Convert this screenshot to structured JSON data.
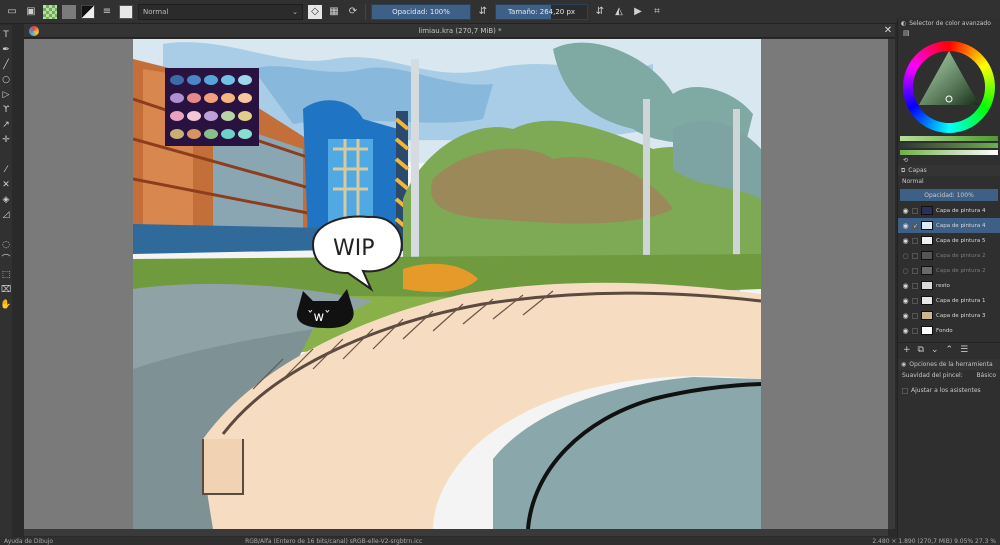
{
  "toolbar": {
    "blend_mode": "Normal",
    "opacity_label": "Opacidad: 100%",
    "opacity_value": 1.0,
    "size_label": "Tamaño: 264,20 px",
    "size_fill": 0.6,
    "icons": [
      "folder-icon",
      "save-icon",
      "gradient-pattern-icon",
      "fill-pattern-icon",
      "swap-colors-icon",
      "brush-settings-icon",
      "brush-preset-icon",
      "eraser-icon",
      "alpha-lock-icon",
      "reload-icon",
      "mirror-horizontal-icon",
      "mirror-vertical-icon",
      "crop-icon"
    ]
  },
  "tabs": {
    "active_title": "limiau.kra (270,7 MiB) *"
  },
  "canvas": {
    "bubble_text": "WIP",
    "cat_text": "ˇwˇ",
    "palette_colors": [
      "#3c6aa8",
      "#4a86c5",
      "#56a5d8",
      "#6fc2e6",
      "#9fd6ea",
      "#b08fd2",
      "#e58a8a",
      "#f0a07a",
      "#f3b680",
      "#f7c7a0",
      "#e9a3c1",
      "#f4c7d6",
      "#c0a0d8",
      "#b9d3a8",
      "#e0d08a",
      "#c8b072",
      "#d49565",
      "#89c08a",
      "#6fd1c9",
      "#86e0d0"
    ]
  },
  "dock": {
    "color_title": "Selector de color avanzado",
    "layers_title": "Capas",
    "layers_blend": "Normal",
    "layers_opacity": "Opacidad:  100%",
    "layers": [
      {
        "name": "Capa de pintura 4",
        "visible": true,
        "selected": false,
        "dim": false,
        "thumb": "#2b2f5a",
        "check": ""
      },
      {
        "name": "Capa de pintura 4",
        "visible": true,
        "selected": true,
        "dim": false,
        "thumb": "#dfeaf3",
        "check": "✓"
      },
      {
        "name": "Capa de pintura 5",
        "visible": true,
        "selected": false,
        "dim": false,
        "thumb": "#f0f0f0",
        "check": ""
      },
      {
        "name": "Capa de pintura 2",
        "visible": false,
        "selected": false,
        "dim": true,
        "thumb": "#555",
        "check": ""
      },
      {
        "name": "Capa de pintura 2",
        "visible": false,
        "selected": false,
        "dim": true,
        "thumb": "#6a6a6a",
        "check": ""
      },
      {
        "name": "resto",
        "visible": true,
        "selected": false,
        "dim": false,
        "thumb": "#d8d8d8",
        "check": ""
      },
      {
        "name": "Capa de pintura 1",
        "visible": true,
        "selected": false,
        "dim": false,
        "thumb": "#e7e7e7",
        "check": ""
      },
      {
        "name": "Capa de pintura 3",
        "visible": true,
        "selected": false,
        "dim": false,
        "thumb": "#c9b98d",
        "check": ""
      },
      {
        "name": "Fondo",
        "visible": true,
        "selected": false,
        "dim": false,
        "thumb": "#ffffff",
        "check": ""
      }
    ],
    "tool_options_title": "Opciones de la herramienta",
    "brush_smoothing_label": "Suavidad del pincel:",
    "brush_smoothing_value": "Básico",
    "assistants_label": "Ajustar a los asistentes"
  },
  "statusbar": {
    "left": "Ayuda de Dibujo",
    "mid": "RGB/Alfa (Entero de 16 bits/canal)  sRGB-elle-V2-srgbtrn.icc",
    "right": "2.480 × 1.890 (270,7 MiB)   9.05%   27.3 %"
  }
}
